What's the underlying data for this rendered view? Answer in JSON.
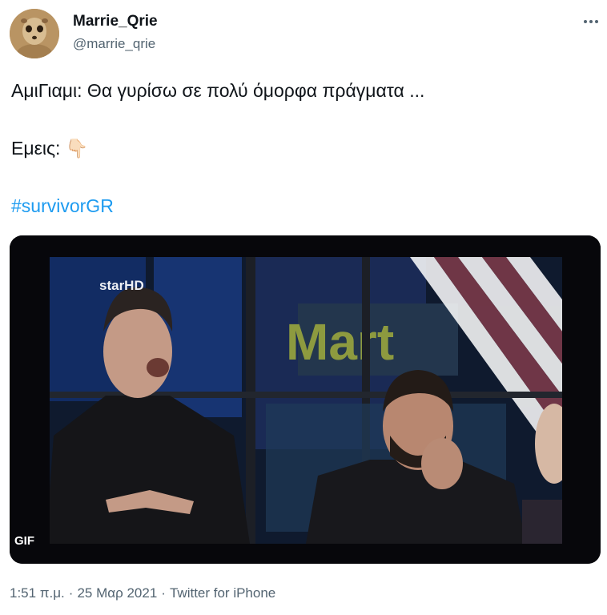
{
  "author": {
    "display_name": "Marrie_Qrie",
    "handle": "@marrie_qrie",
    "avatar_icon": "meerkat-avatar"
  },
  "menu": {
    "icon": "more-horizontal-icon"
  },
  "tweet": {
    "line1": "ΑμιΓιαμι: Θα γυρίσω σε πολύ όμορφα πράγματα ...",
    "line2_text": "Εμεις:",
    "line2_emoji": "👇🏻",
    "hashtag": "#survivorGR"
  },
  "media": {
    "type": "animated GIF",
    "badge": "GIF",
    "channel_logo": "starHD",
    "background_sign": "Mart"
  },
  "meta": {
    "time": "1:51 π.μ.",
    "date": "25 Μαρ 2021",
    "source": "Twitter for iPhone"
  },
  "colors": {
    "link": "#1d9bf0",
    "secondary_text": "#536471",
    "primary_text": "#0f1419"
  }
}
